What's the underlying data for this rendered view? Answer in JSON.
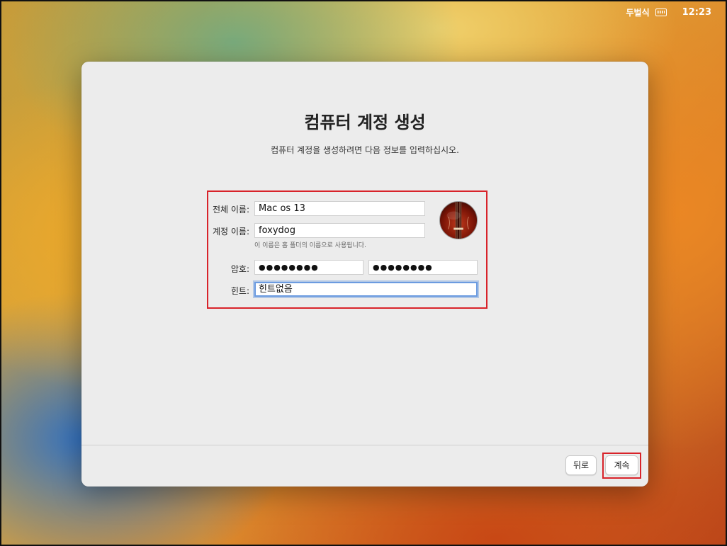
{
  "menubar": {
    "input_source": "두벌식",
    "keyboard_icon": "keyboard-icon",
    "clock": "12:23"
  },
  "dialog": {
    "title": "컴퓨터 계정 생성",
    "subtitle": "컴퓨터 계정을 생성하려면 다음 정보를 입력하십시오."
  },
  "form": {
    "full_name_label": "전체 이름:",
    "full_name_value": "Mac os 13",
    "account_name_label": "계정 이름:",
    "account_name_value": "foxydog",
    "account_name_note": "이 이름은 홈 폴더의 이름으로 사용됩니다.",
    "password_label": "암호:",
    "password_value": "●●●●●●●●",
    "password_verify_value": "●●●●●●●●",
    "hint_label": "힌트:",
    "hint_value": "힌트없음"
  },
  "avatar": {
    "icon": "violin-icon"
  },
  "buttons": {
    "back": "뒤로",
    "continue": "계속"
  }
}
